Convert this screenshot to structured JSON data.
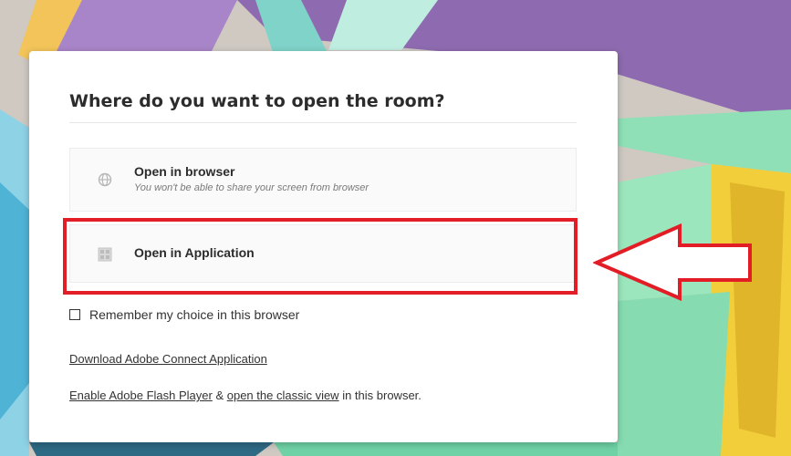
{
  "dialog": {
    "title": "Where do you want to open the room?",
    "options": [
      {
        "label": "Open in browser",
        "sublabel": "You won't be able to share your screen from browser",
        "icon": "globe-icon"
      },
      {
        "label": "Open in Application",
        "icon": "app-icon"
      }
    ],
    "remember_label": "Remember my choice in this browser",
    "remember_checked": false,
    "download_link": "Download Adobe Connect Application",
    "flash_link": "Enable Adobe Flash Player",
    "flash_connector": " & ",
    "classic_link": "open the classic view",
    "flash_suffix": " in this browser."
  },
  "annotation": {
    "highlight_color": "#e21d26",
    "arrow_color": "#e21d26"
  }
}
